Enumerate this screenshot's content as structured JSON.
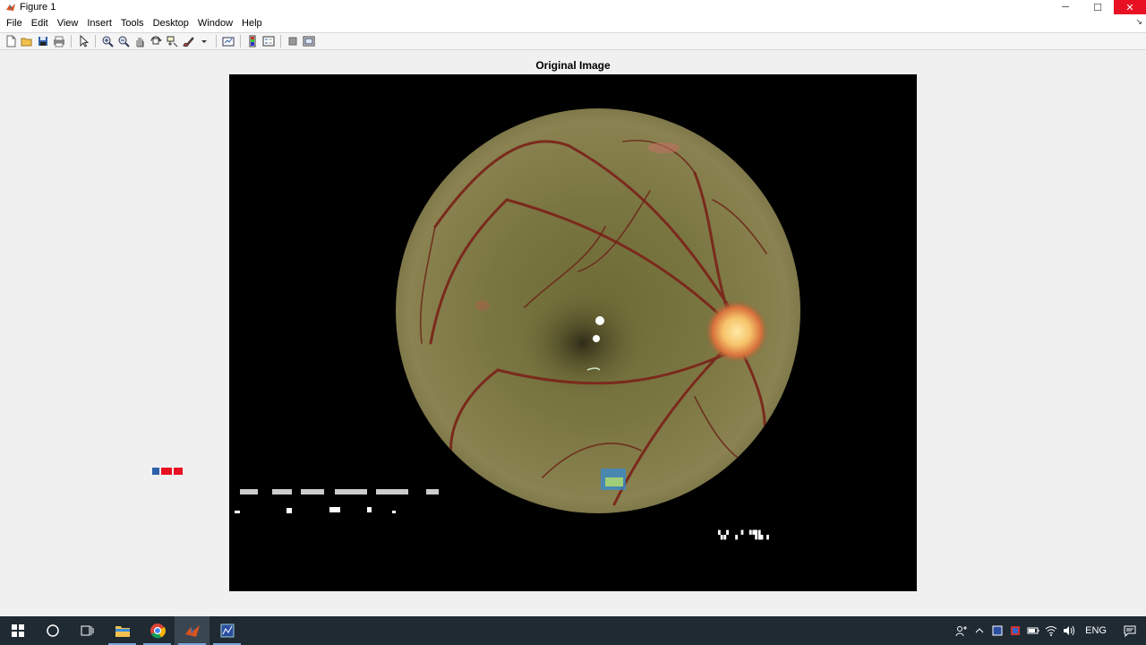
{
  "window": {
    "title": "Figure 1",
    "controls": {
      "minimize": "─",
      "maximize": "☐",
      "close": "✕"
    }
  },
  "menubar": {
    "items": [
      "File",
      "Edit",
      "View",
      "Insert",
      "Tools",
      "Desktop",
      "Window",
      "Help"
    ]
  },
  "toolbar": {
    "buttons": [
      "new-figure-icon",
      "open-file-icon",
      "save-icon",
      "print-icon",
      "edit-plot-icon",
      "zoom-in-icon",
      "zoom-out-icon",
      "pan-icon",
      "rotate-3d-icon",
      "data-cursor-icon",
      "brush-icon",
      "link-plot-icon",
      "insert-colorbar-icon",
      "insert-legend-icon",
      "hide-plot-tools-icon",
      "show-plot-tools-icon"
    ]
  },
  "figure": {
    "axes_title": "Original Image"
  },
  "taskbar": {
    "apps": [
      "start-icon",
      "search-icon",
      "task-view-icon",
      "file-explorer-icon",
      "chrome-icon",
      "matlab-icon",
      "figure-window-icon"
    ],
    "tray_language": "ENG"
  },
  "colors": {
    "titlebar": "#ffffff",
    "close_button": "#e81123",
    "figure_background": "#f0f0f0",
    "axes_background": "#000000",
    "taskbar": "#1f2a33",
    "fundus_base": "#7a7440",
    "optic_disc": "#f6c36a"
  }
}
